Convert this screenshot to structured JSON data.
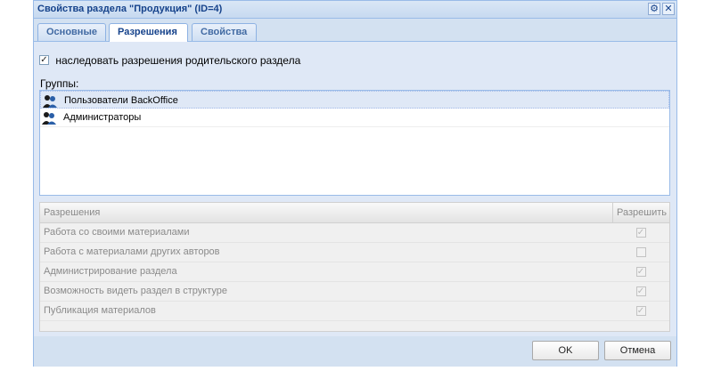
{
  "window": {
    "title": "Свойства раздела \"Продукция\" (ID=4)",
    "tools": [
      {
        "name": "gear-icon",
        "glyph": "⚙"
      },
      {
        "name": "close-icon",
        "glyph": "✕"
      }
    ]
  },
  "tabs": [
    {
      "label": "Основные",
      "active": false
    },
    {
      "label": "Разрешения",
      "active": true
    },
    {
      "label": "Свойства",
      "active": false
    }
  ],
  "inherit": {
    "checked": true,
    "label": "наследовать разрешения родительского раздела"
  },
  "groups": {
    "label": "Группы:",
    "items": [
      {
        "label": "Пользователи BackOffice",
        "icon": "user-group-icon",
        "selected": true
      },
      {
        "label": "Администраторы",
        "icon": "user-group-icon",
        "selected": false
      }
    ]
  },
  "permissions": {
    "columns": [
      "Разрешения",
      "Разрешить"
    ],
    "rows": [
      {
        "label": "Работа со своими материалами",
        "allowed": true
      },
      {
        "label": "Работа с материалами других авторов",
        "allowed": false
      },
      {
        "label": "Администрирование раздела",
        "allowed": true
      },
      {
        "label": "Возможность видеть раздел в структуре",
        "allowed": true
      },
      {
        "label": "Публикация материалов",
        "allowed": true
      }
    ]
  },
  "buttons": {
    "ok": "OK",
    "cancel": "Отмена"
  }
}
